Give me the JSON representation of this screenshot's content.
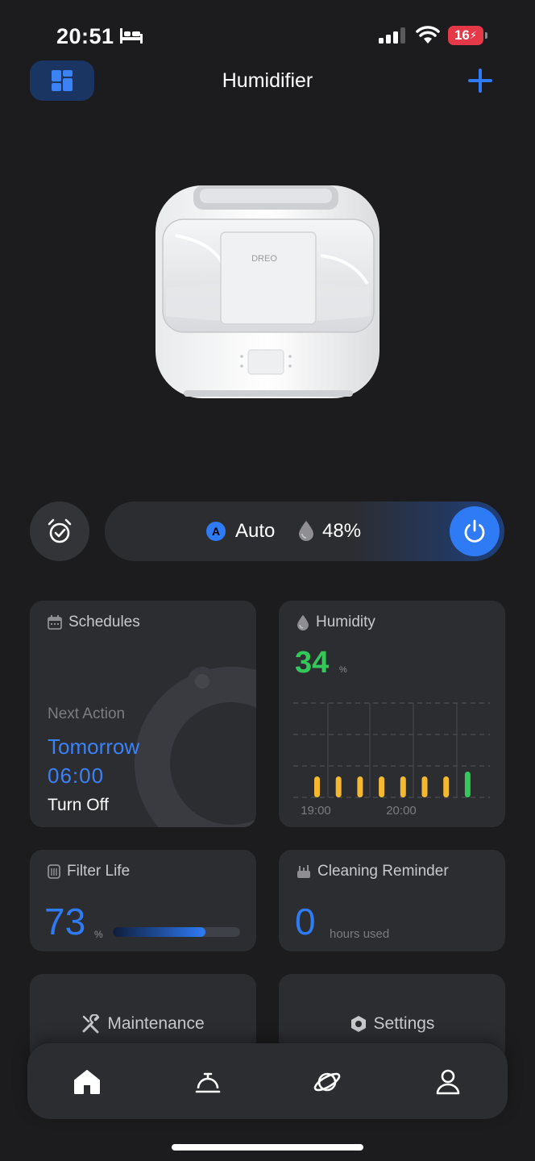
{
  "status_bar": {
    "time": "20:51",
    "battery_level": "16"
  },
  "header": {
    "title": "Humidifier"
  },
  "device": {
    "brand_mark": "DREO"
  },
  "control": {
    "mode_badge": "A",
    "mode": "Auto",
    "target_humidity": "48%"
  },
  "cards": {
    "schedules": {
      "title": "Schedules",
      "next_label": "Next Action",
      "next_day": "Tomorrow",
      "next_time": "06:00",
      "next_action": "Turn Off"
    },
    "humidity": {
      "title": "Humidity",
      "value": "34",
      "unit": "%"
    },
    "filter": {
      "title": "Filter Life",
      "value": "73",
      "unit": "%",
      "percent": 73
    },
    "cleaning": {
      "title": "Cleaning Reminder",
      "value": "0",
      "unit": "hours used"
    },
    "maintenance": {
      "label": "Maintenance"
    },
    "settings": {
      "label": "Settings"
    }
  },
  "chart_data": {
    "type": "bar",
    "x_tick_labels": [
      "19:00",
      "20:00"
    ],
    "values": [
      1,
      1,
      1,
      1,
      1,
      1,
      1,
      1
    ],
    "colors": [
      "#f5b82e",
      "#f5b82e",
      "#f5b82e",
      "#f5b82e",
      "#f5b82e",
      "#f5b82e",
      "#f5b82e",
      "#34c759"
    ],
    "grid": true
  },
  "tabs": [
    {
      "name": "home",
      "icon": "home-icon",
      "active": true
    },
    {
      "name": "service",
      "icon": "bell-icon",
      "active": false
    },
    {
      "name": "discover",
      "icon": "planet-icon",
      "active": false
    },
    {
      "name": "profile",
      "icon": "person-icon",
      "active": false
    }
  ],
  "colors": {
    "accent": "#2f7bf5",
    "good": "#34c759",
    "warn": "#f5b82e",
    "background": "#1c1c1e",
    "card": "#2c2d31"
  }
}
